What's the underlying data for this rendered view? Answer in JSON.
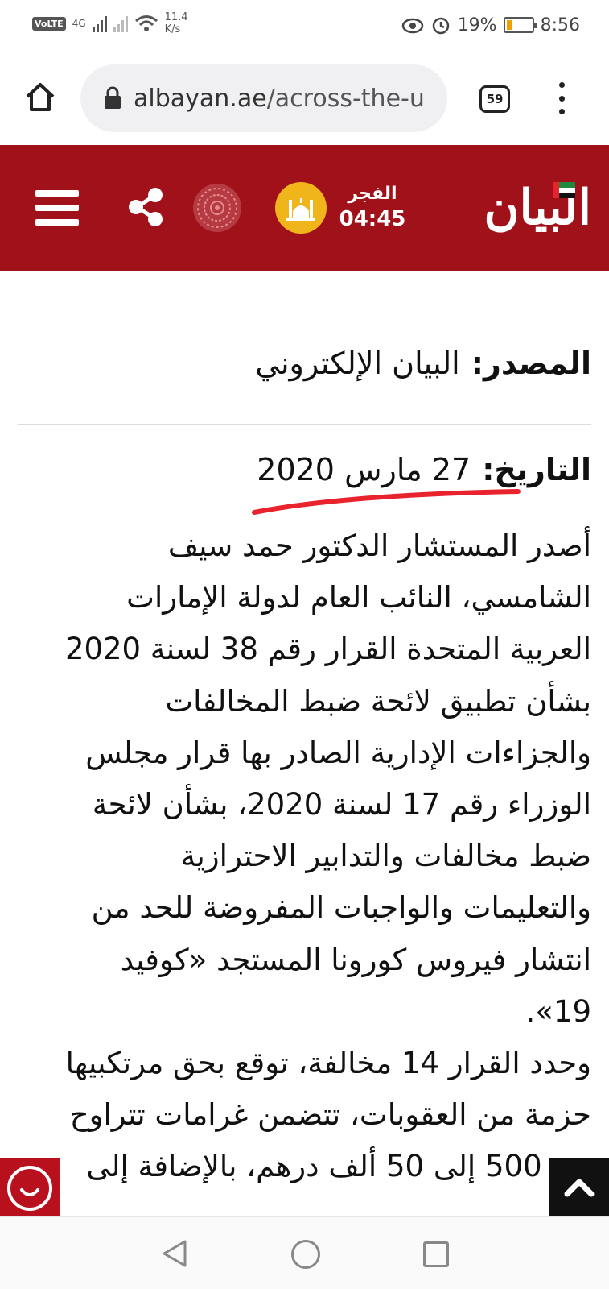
{
  "status_bar": {
    "network_label": "VoLTE",
    "network_type": "4G",
    "net_speed_value": "11.4",
    "net_speed_unit": "K/s",
    "battery_percent": "19%",
    "battery_level": 0.19,
    "time": "8:56",
    "colors": {
      "battery_fill": "#f0a000"
    }
  },
  "browser": {
    "url_domain": "albayan.ae",
    "url_path": "/across-the-u",
    "tab_count": "59",
    "icons": {
      "home": "home-icon",
      "lock": "lock-icon",
      "menu": "more-vert-icon"
    }
  },
  "site_header": {
    "logo_text": "البيان",
    "prayer_name": "الفجر",
    "prayer_time": "04:45",
    "colors": {
      "background": "#a0111a",
      "mosque_badge": "#f1b51c"
    },
    "icons": {
      "menu": "hamburger-icon",
      "share": "share-icon",
      "pattern": "islamic-pattern-icon",
      "mosque": "mosque-icon"
    }
  },
  "article": {
    "source_label": "المصدر:",
    "source_value": "البيان الإلكتروني",
    "date_label": "التاريخ:",
    "date_value": "27 مارس 2020",
    "annotation_color": "#e8232e",
    "paragraph1_lines": [
      "أصدر المستشار الدكتور حمد سيف",
      "الشامسي، النائب العام لدولة الإمارات",
      "العربية المتحدة القرار رقم 38 لسنة 2020",
      "بشأن تطبيق لائحة ضبط المخالفات",
      "والجزاءات الإدارية الصادر بها قرار مجلس",
      "الوزراء رقم 17 لسنة 2020، بشأن لائحة",
      "ضبط مخالفات والتدابير الاحترازية",
      "والتعليمات والواجبات المفروضة للحد من",
      "انتشار فيروس كورونا المستجد «كوفيد",
      "19»."
    ],
    "paragraph2_lines": [
      "وحدد القرار 14 مخالفة، توقع بحق مرتكبيها",
      "حزمة من العقوبات، تتضمن غرامات تتراوح",
      "بين 500 إلى 50 ألف درهم، بالإضافة إلى"
    ]
  },
  "floating": {
    "chat_icon": "chat-smile-icon",
    "scroll_top_icon": "chevron-up-icon",
    "colors": {
      "chat": "#b9101d",
      "scroll_top": "#111111"
    }
  },
  "nav_bar": {
    "icons": {
      "back": "back-triangle-icon",
      "home": "home-circle-icon",
      "recents": "recents-square-icon"
    }
  }
}
